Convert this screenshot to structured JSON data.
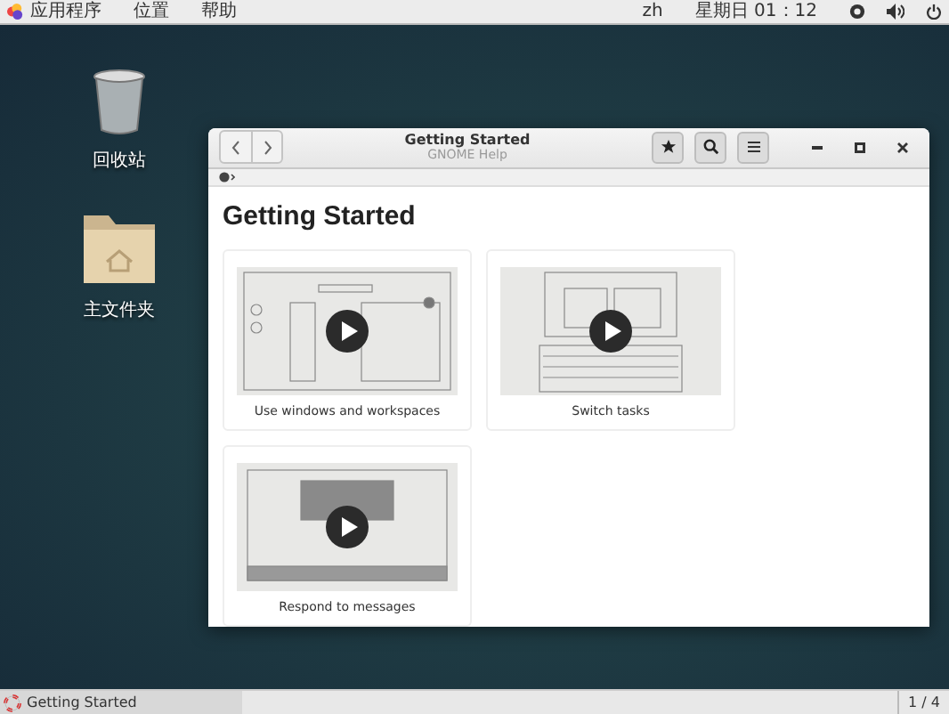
{
  "top_bar": {
    "menus": [
      "应用程序",
      "位置",
      "帮助"
    ],
    "language": "zh",
    "clock": "星期日 01：12"
  },
  "desktop_icons": [
    {
      "kind": "trash",
      "label": "回收站"
    },
    {
      "kind": "folder",
      "label": "主文件夹"
    }
  ],
  "window": {
    "title": "Getting Started",
    "subtitle": "GNOME Help",
    "heading": "Getting Started",
    "cards": [
      {
        "kind": "windows",
        "label": "Use windows and workspaces"
      },
      {
        "kind": "keyboard",
        "label": "Switch tasks"
      },
      {
        "kind": "message",
        "label": "Respond to messages"
      }
    ]
  },
  "taskbar": {
    "item": "Getting Started",
    "workspace": "1 / 4"
  }
}
